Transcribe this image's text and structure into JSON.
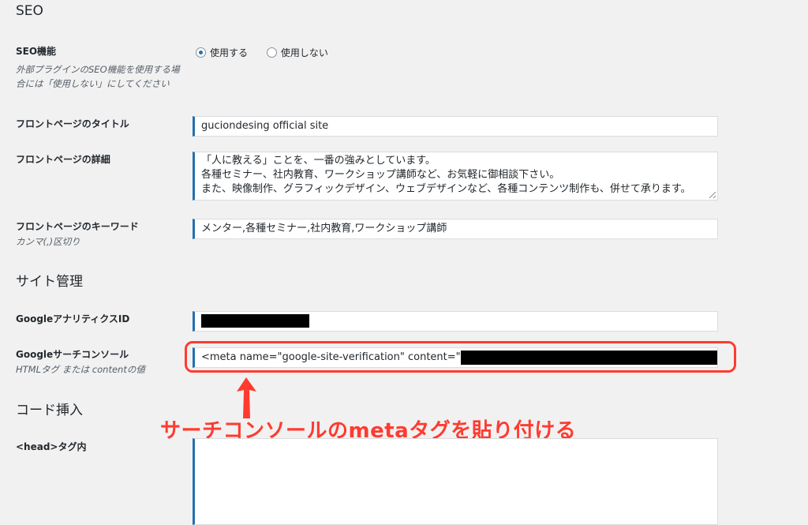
{
  "sections": {
    "seo_title": "SEO",
    "site_title": "サイト管理",
    "code_title": "コード挿入"
  },
  "seo": {
    "function_label": "SEO機能",
    "function_desc": "外部プラグインのSEO機能を使用する場合には「使用しない」にしてください",
    "radio_use": "使用する",
    "radio_not_use": "使用しない",
    "selected": "使用する",
    "front_title_label": "フロントページのタイトル",
    "front_title_value": "guciondesing official site",
    "front_detail_label": "フロントページの詳細",
    "front_detail_lines": [
      "「人に教える」ことを、一番の強みとしています。",
      "各種セミナー、社内教育、ワークショップ講師など、お気軽に御相談下さい。",
      "また、映像制作、グラフィックデザイン、ウェブデザインなど、各種コンテンツ制作も、併せて承ります。"
    ],
    "keywords_label": "フロントページのキーワード",
    "keywords_desc": "カンマ(,)区切り",
    "keywords_value": "メンター,各種セミナー,社内教育,ワークショップ講師"
  },
  "site": {
    "ga_label": "GoogleアナリティクスID",
    "gsc_label": "Googleサーチコンソール",
    "gsc_desc": "HTMLタグ または contentの値",
    "gsc_value_prefix": "<meta name=\"google-site-verification\" content=\""
  },
  "code": {
    "head_label": "<head>タグ内",
    "head_value": ""
  },
  "annotation": {
    "text": "サーチコンソールのmetaタグを貼り付ける",
    "color": "#ff3b30"
  },
  "colors": {
    "accent": "#2271b1",
    "background": "#f1f1f1"
  }
}
